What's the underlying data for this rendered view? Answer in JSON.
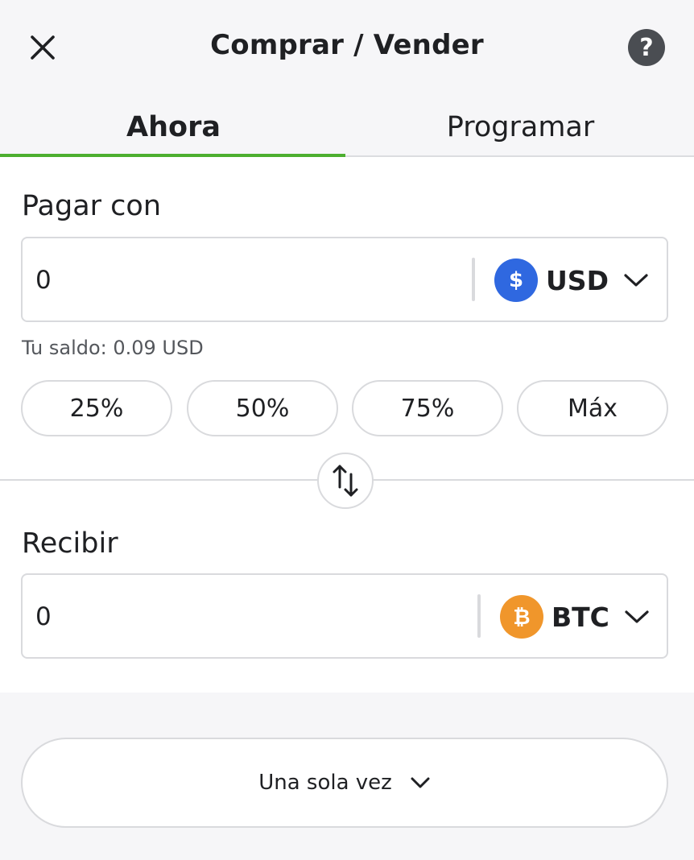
{
  "header": {
    "title": "Comprar / Vender",
    "close_icon": "close-icon",
    "help_label": "?"
  },
  "tabs": [
    {
      "label": "Ahora",
      "active": true
    },
    {
      "label": "Programar",
      "active": false
    }
  ],
  "pay": {
    "label": "Pagar con",
    "amount": "0",
    "currency": "USD",
    "currency_symbol": "$",
    "balance": "Tu saldo: 0.09 USD"
  },
  "percent_buttons": [
    "25%",
    "50%",
    "75%",
    "Máx"
  ],
  "receive": {
    "label": "Recibir",
    "amount": "0",
    "currency": "BTC",
    "currency_symbol": "₿"
  },
  "frequency": {
    "label": "Una sola vez"
  },
  "colors": {
    "accent": "#4caf2f",
    "usd": "#2f68e0",
    "btc": "#f0962b"
  }
}
